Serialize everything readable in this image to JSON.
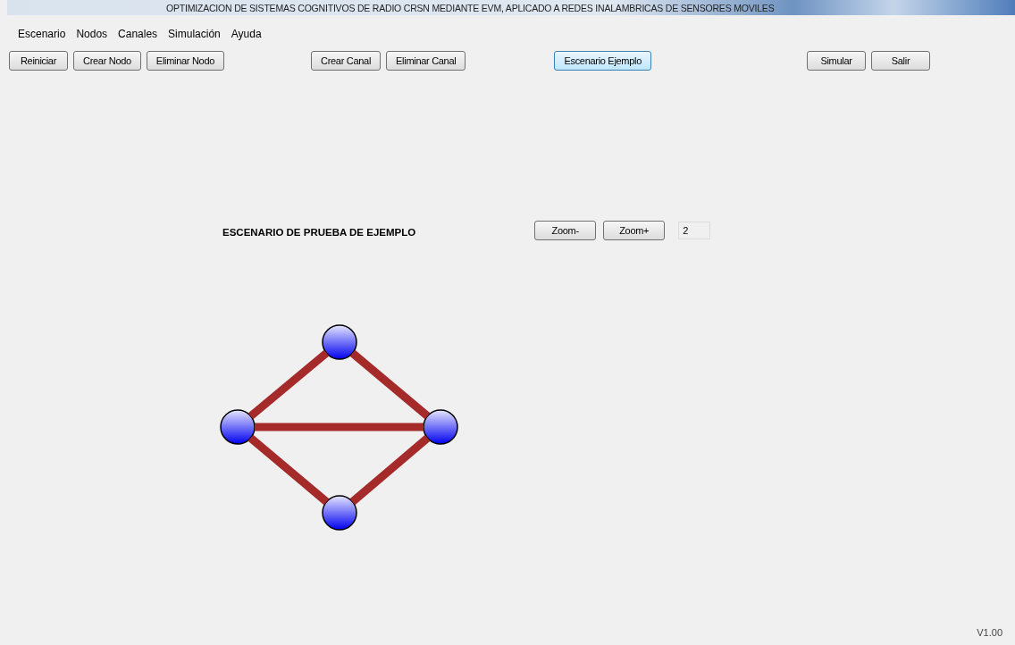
{
  "window": {
    "title": "OPTIMIZACION DE SISTEMAS COGNITIVOS DE RADIO CRSN MEDIANTE EVM, APLICADO A  REDES INALAMBRICAS DE SENSORES MOVILES"
  },
  "menu": [
    "Escenario",
    "Nodos",
    "Canales",
    "Simulación",
    "Ayuda"
  ],
  "toolbar_groups": [
    {
      "buttons": [
        {
          "label": "Reiniciar",
          "focused": false
        },
        {
          "label": "Crear Nodo",
          "focused": false
        },
        {
          "label": "Eliminar Nodo",
          "focused": false
        }
      ]
    },
    {
      "buttons": [
        {
          "label": "Crear Canal",
          "focused": false
        },
        {
          "label": "Eliminar Canal",
          "focused": false
        }
      ]
    },
    {
      "buttons": [
        {
          "label": "Escenario Ejemplo",
          "focused": true
        }
      ]
    },
    {
      "buttons": [
        {
          "label": "Simular",
          "focused": false
        },
        {
          "label": "Salir",
          "focused": false
        }
      ]
    }
  ],
  "scenario_title": "ESCENARIO DE PRUEBA DE EJEMPLO",
  "zoom_buttons": [
    "Zoom-",
    "Zoom+"
  ],
  "zoom_value": "2",
  "version": "V1.00"
}
